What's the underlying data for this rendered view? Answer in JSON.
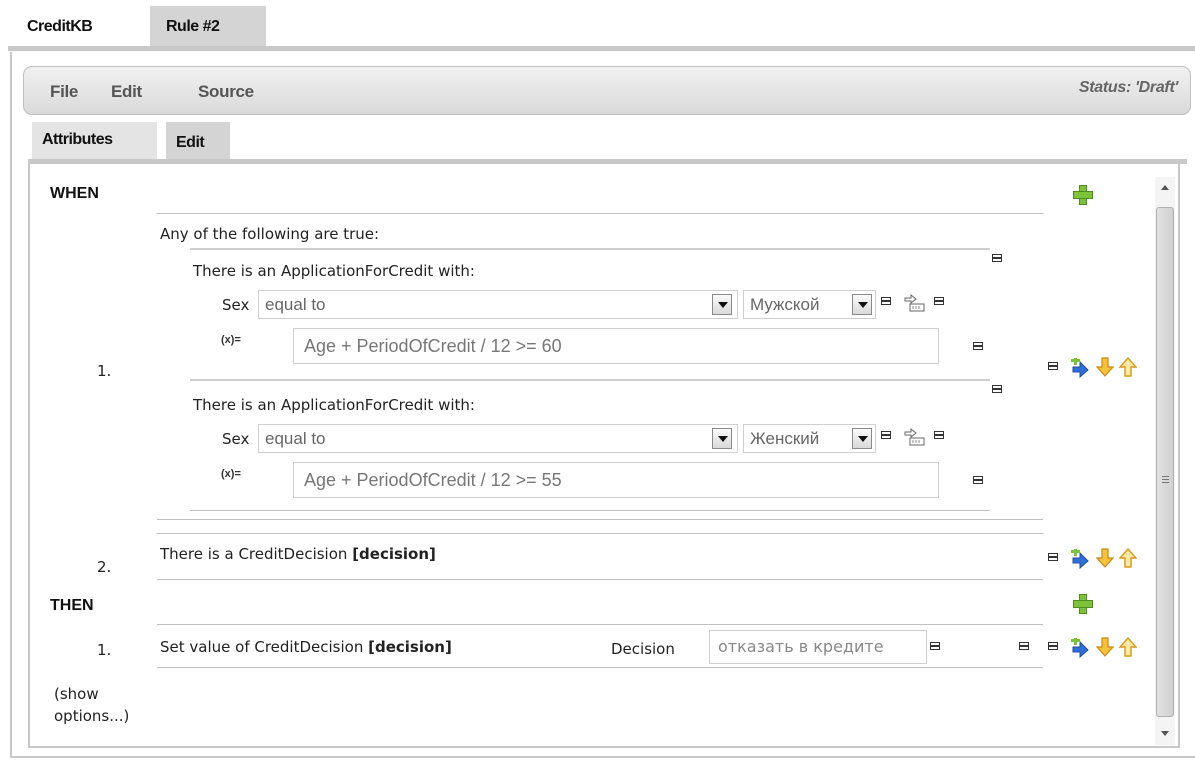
{
  "tabs": {
    "knowledge_base": "CreditKB",
    "rule": "Rule #2"
  },
  "menu": {
    "file": "File",
    "edit": "Edit",
    "source": "Source"
  },
  "status": "Status: 'Draft'",
  "sub_tabs": {
    "attributes": "Attributes",
    "edit": "Edit"
  },
  "rule": {
    "when_label": "WHEN",
    "then_label": "THEN",
    "conditions": [
      {
        "number": "1.",
        "title": "Any of the following are true:",
        "patterns": [
          {
            "header": "There is an ApplicationForCredit with:",
            "field": "Sex",
            "operator": "equal to",
            "value": "Мужской",
            "expr_label": "(x)=",
            "expression": "Age + PeriodOfCredit / 12 >= 60"
          },
          {
            "header": "There is an ApplicationForCredit with:",
            "field": "Sex",
            "operator": "equal to",
            "value": "Женский",
            "expr_label": "(x)=",
            "expression": "Age + PeriodOfCredit / 12 >= 55"
          }
        ]
      },
      {
        "number": "2.",
        "prefix": "There is a CreditDecision ",
        "binding": "[decision]"
      }
    ],
    "actions": [
      {
        "number": "1.",
        "prefix": "Set value of CreditDecision ",
        "binding": "[decision]",
        "field": "Decision",
        "value": "отказать в кредите"
      }
    ],
    "show_options_line1": "(show",
    "show_options_line2": "options...)"
  },
  "icons": {
    "add": "plus-icon",
    "insert": "insert-icon",
    "move_down": "arrow-down-icon",
    "move_up": "arrow-up-icon",
    "remove": "remove-icon",
    "value_picker": "value-picker-icon"
  },
  "colors": {
    "add_green": "#7cc33a",
    "arrow_orange": "#f4b41a",
    "insert_blue": "#2f6fd8"
  }
}
